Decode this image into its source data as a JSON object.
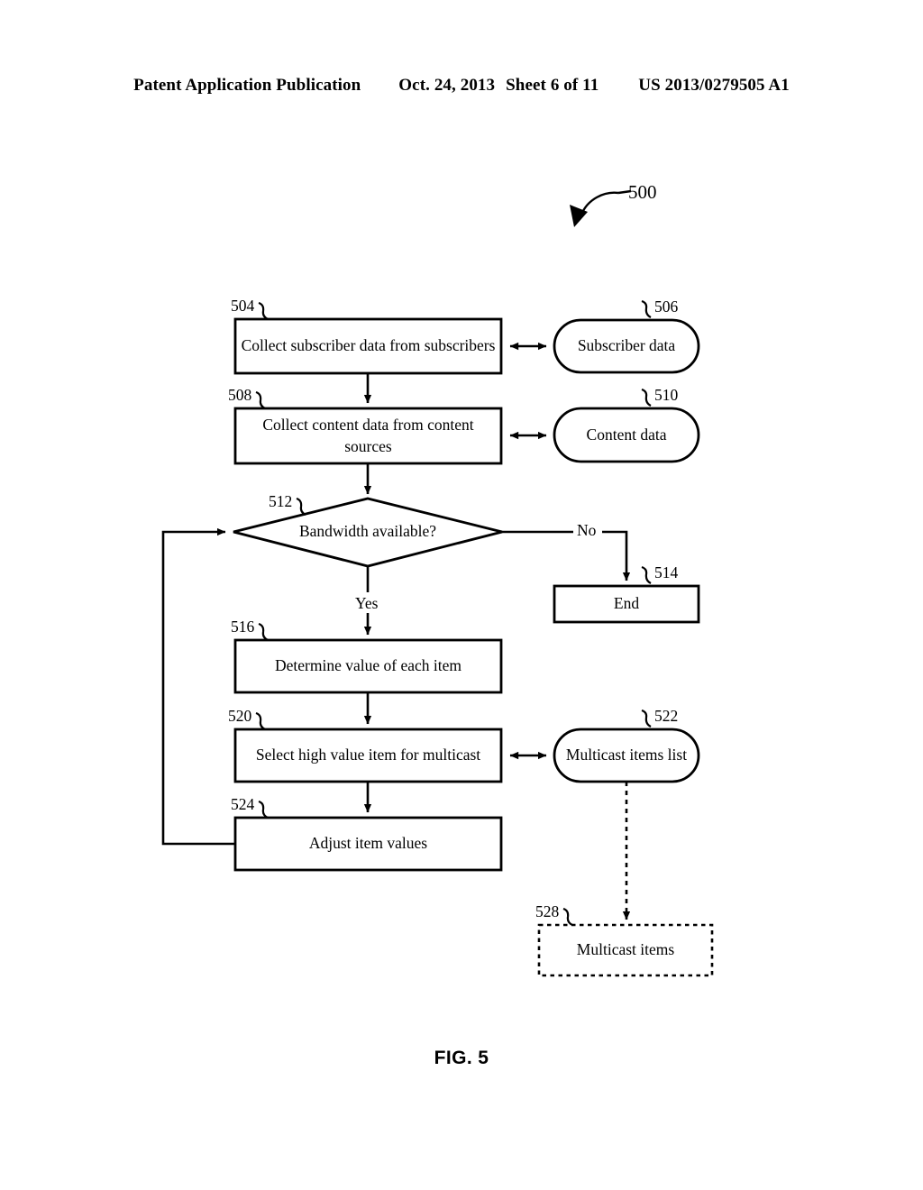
{
  "header": {
    "publication": "Patent Application Publication",
    "date": "Oct. 24, 2013",
    "sheet": "Sheet 6 of 11",
    "patent_number": "US 2013/0279505 A1"
  },
  "figure": {
    "caption": "FIG. 5",
    "diagram_ref": "500"
  },
  "nodes": [
    {
      "ref": "504",
      "label": "Collect subscriber data from subscribers",
      "shape": "process"
    },
    {
      "ref": "506",
      "label": "Subscriber data",
      "shape": "stadium"
    },
    {
      "ref": "508",
      "label": "Collect content data from content sources",
      "shape": "process"
    },
    {
      "ref": "510",
      "label": "Content data",
      "shape": "stadium"
    },
    {
      "ref": "512",
      "label": "Bandwidth available?",
      "shape": "decision"
    },
    {
      "ref": "514",
      "label": "End",
      "shape": "process"
    },
    {
      "ref": "516",
      "label": "Determine value of each item",
      "shape": "process"
    },
    {
      "ref": "520",
      "label": "Select high value item for multicast",
      "shape": "process"
    },
    {
      "ref": "522",
      "label": "Multicast items list",
      "shape": "stadium"
    },
    {
      "ref": "524",
      "label": "Adjust item values",
      "shape": "process"
    },
    {
      "ref": "528",
      "label": "Multicast items",
      "shape": "dotted-process"
    }
  ],
  "edge_labels": {
    "yes": "Yes",
    "no": "No"
  },
  "colors": {
    "stroke": "#000000",
    "background": "#ffffff",
    "text": "#000000"
  }
}
